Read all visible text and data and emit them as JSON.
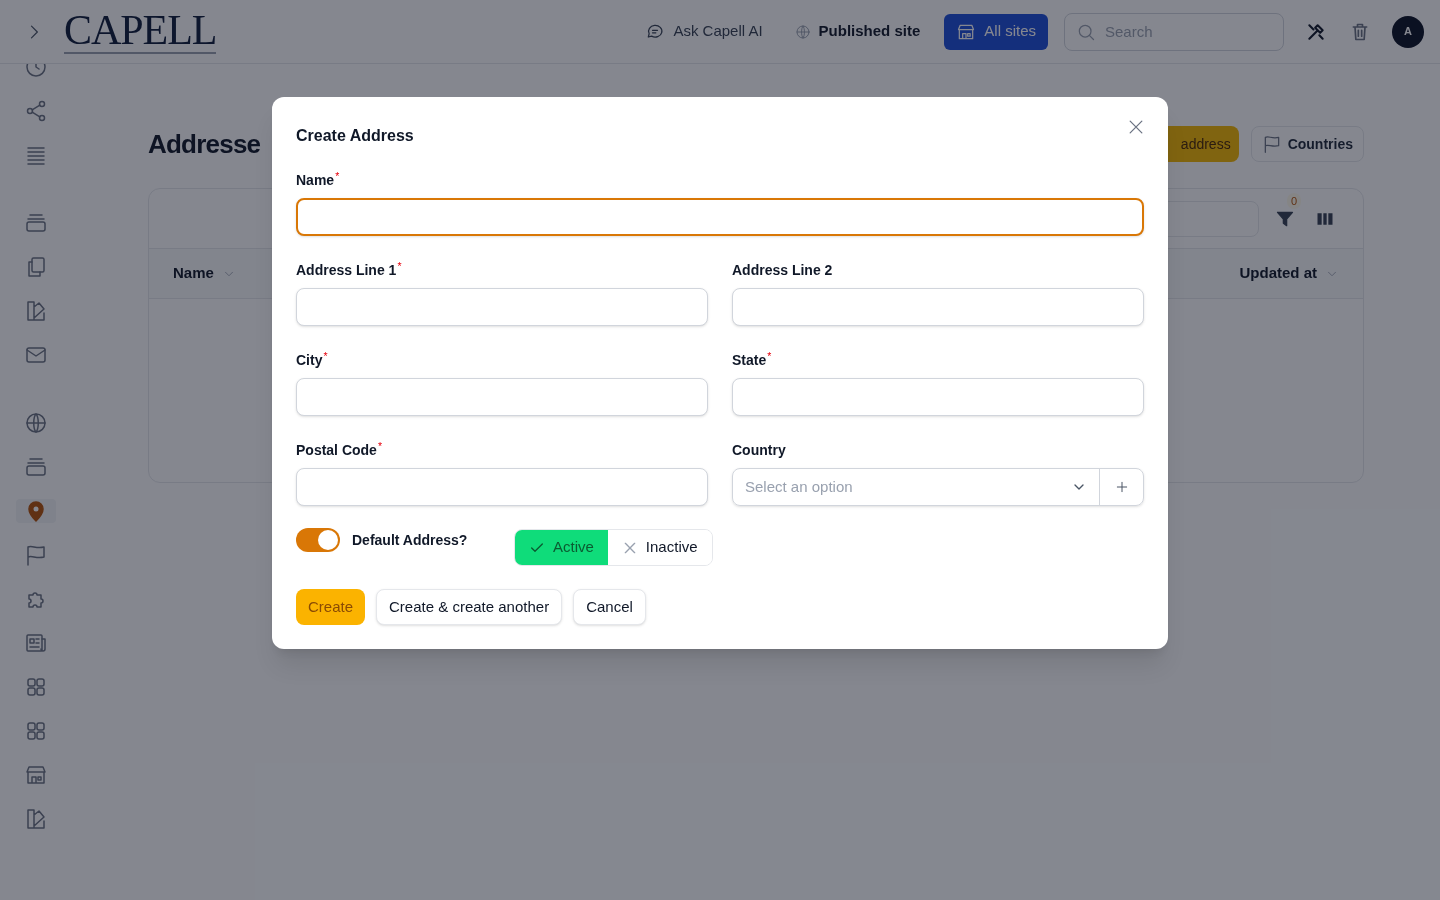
{
  "header": {
    "logo": "CAPELL",
    "links": [
      {
        "kind": "chat",
        "label": "Ask Capell AI"
      },
      {
        "kind": "globe",
        "label": "Published site"
      }
    ],
    "sites_button": "All sites",
    "search": {
      "placeholder": "Search"
    },
    "avatar": "A"
  },
  "sidebar": {
    "groups": [
      [
        {
          "kind": "clock",
          "selected": false
        },
        {
          "kind": "share",
          "selected": false
        },
        {
          "kind": "lines",
          "selected": false
        }
      ],
      [
        {
          "kind": "archive",
          "selected": false
        },
        {
          "kind": "copy",
          "selected": false
        },
        {
          "kind": "swatch",
          "selected": false
        },
        {
          "kind": "mail",
          "selected": false
        }
      ],
      [
        {
          "kind": "globe",
          "selected": false
        },
        {
          "kind": "archive",
          "selected": false
        },
        {
          "kind": "pin",
          "selected": true
        },
        {
          "kind": "flag",
          "selected": false
        },
        {
          "kind": "puzzle",
          "selected": false
        },
        {
          "kind": "news",
          "selected": false
        },
        {
          "kind": "grid",
          "selected": false
        },
        {
          "kind": "grid",
          "selected": false
        },
        {
          "kind": "store",
          "selected": false
        },
        {
          "kind": "swatch",
          "selected": false
        }
      ]
    ]
  },
  "page": {
    "title": "Addresse",
    "actions": [
      {
        "kind": "primary",
        "label": "address"
      },
      {
        "kind": "flag",
        "label": "Countries"
      }
    ],
    "table": {
      "filter_count": "0",
      "columns": [
        {
          "label": "Name"
        },
        {
          "label": "Updated at"
        }
      ]
    }
  },
  "modal": {
    "title": "Create Address",
    "fields": [
      {
        "kind": "text",
        "label": "Name",
        "required_mark": "*",
        "focused": true,
        "wide": true
      },
      {
        "kind": "text",
        "label": "Address Line 1",
        "required_mark": "*",
        "focused": false,
        "wide": false
      },
      {
        "kind": "text",
        "label": "Address Line 2",
        "focused": false,
        "wide": false
      },
      {
        "kind": "text",
        "label": "City",
        "required_mark": "*",
        "focused": false,
        "wide": false
      },
      {
        "kind": "text",
        "label": "State",
        "required_mark": "*",
        "focused": false,
        "wide": false
      },
      {
        "kind": "text",
        "label": "Postal Code",
        "required_mark": "*",
        "focused": false,
        "wide": false
      },
      {
        "kind": "select",
        "label": "Country",
        "placeholder": "Select an option"
      }
    ],
    "toggle": {
      "label": "Default Address?",
      "on": true
    },
    "status": [
      {
        "label": "Active",
        "selected": true
      },
      {
        "label": "Inactive",
        "selected": false
      }
    ],
    "buttons": [
      {
        "kind": "primary",
        "label": "Create"
      },
      {
        "kind": "secondary",
        "label": "Create & create another"
      },
      {
        "kind": "secondary",
        "label": "Cancel"
      }
    ]
  }
}
